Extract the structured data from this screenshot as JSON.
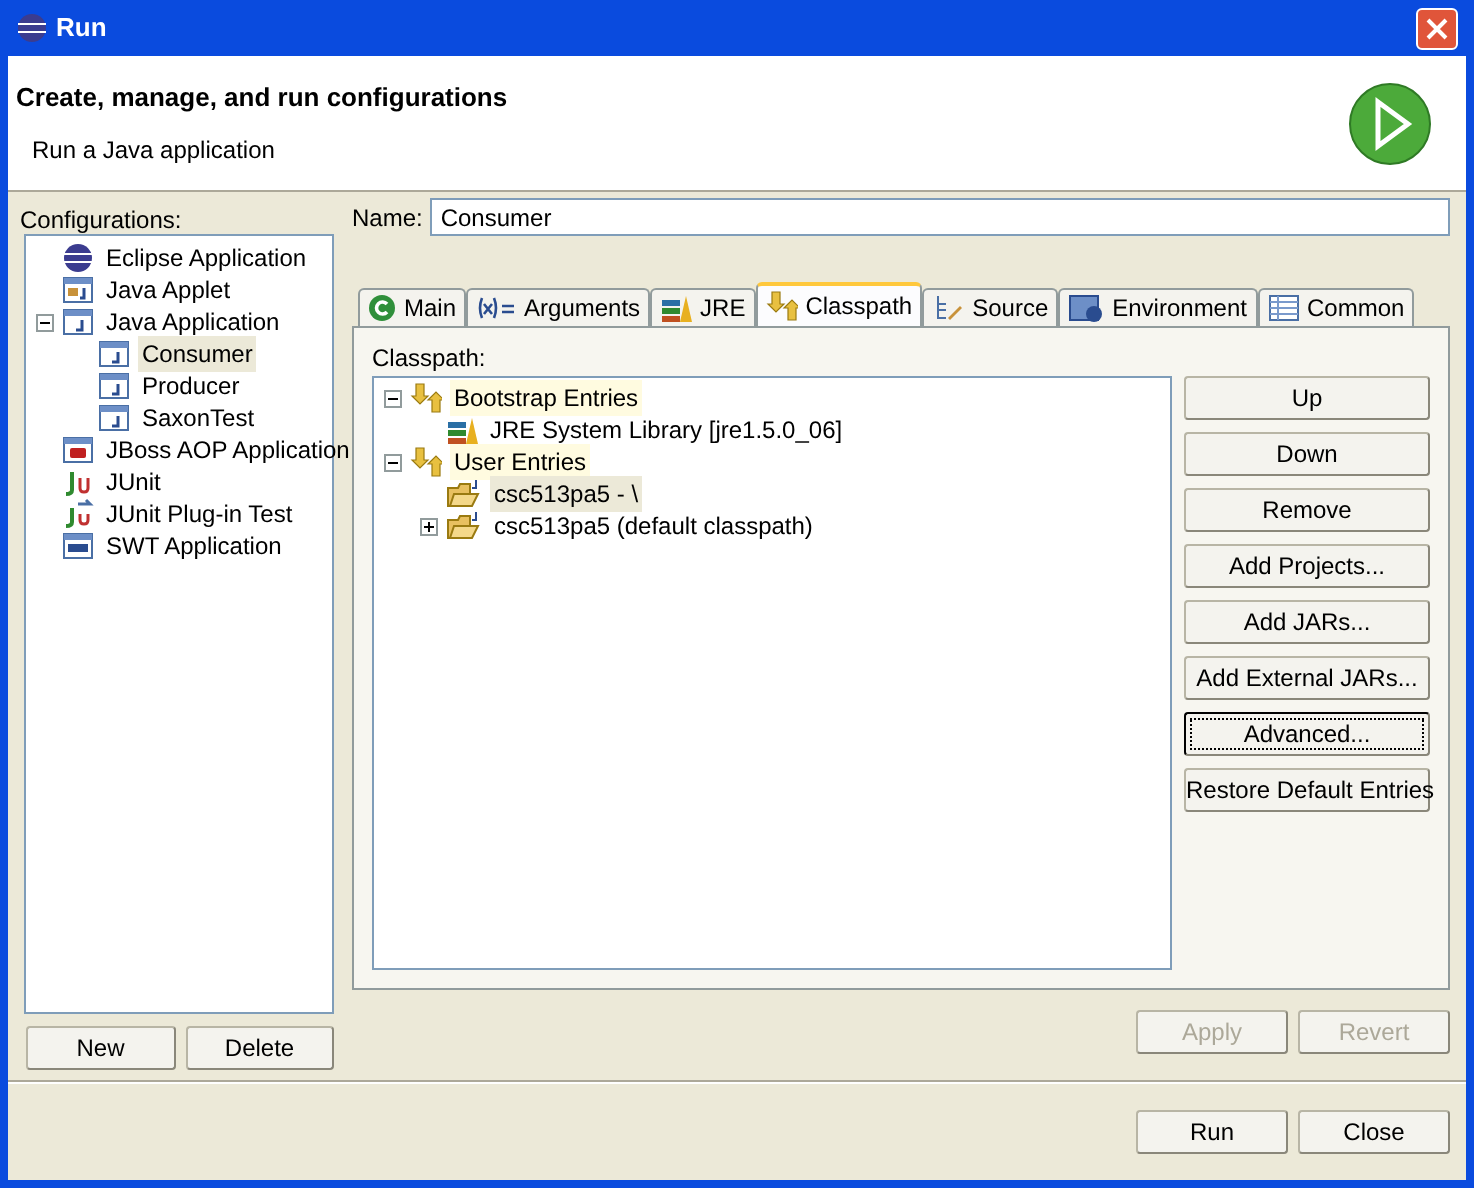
{
  "window": {
    "title": "Run"
  },
  "header": {
    "title": "Create, manage, and run configurations",
    "subtitle": "Run a Java application"
  },
  "configurations": {
    "label": "Configurations:",
    "items": [
      {
        "label": "Eclipse Application",
        "kind": "eclipse",
        "selected": false
      },
      {
        "label": "Java Applet",
        "kind": "applet",
        "selected": false
      },
      {
        "label": "Java Application",
        "kind": "java",
        "selected": false,
        "expanded": true,
        "children": [
          {
            "label": "Consumer",
            "kind": "java",
            "selected": true
          },
          {
            "label": "Producer",
            "kind": "java",
            "selected": false
          },
          {
            "label": "SaxonTest",
            "kind": "java",
            "selected": false
          }
        ]
      },
      {
        "label": "JBoss AOP Application",
        "kind": "jboss",
        "selected": false
      },
      {
        "label": "JUnit",
        "kind": "junit",
        "selected": false
      },
      {
        "label": "JUnit Plug-in Test",
        "kind": "junitplugin",
        "selected": false
      },
      {
        "label": "SWT Application",
        "kind": "swt",
        "selected": false
      }
    ],
    "buttons": [
      "New",
      "Delete"
    ]
  },
  "name": {
    "label": "Name:",
    "value": "Consumer"
  },
  "tabs": [
    {
      "label": "Main",
      "kind": "main",
      "selected": false
    },
    {
      "label": "Arguments",
      "kind": "args",
      "selected": false
    },
    {
      "label": "JRE",
      "kind": "jre",
      "selected": false
    },
    {
      "label": "Classpath",
      "kind": "classpath",
      "selected": true
    },
    {
      "label": "Source",
      "kind": "source",
      "selected": false
    },
    {
      "label": "Environment",
      "kind": "env",
      "selected": false
    },
    {
      "label": "Common",
      "kind": "common",
      "selected": false
    }
  ],
  "classpath": {
    "label": "Classpath:",
    "items": [
      {
        "label": "Bootstrap Entries",
        "kind": "category",
        "selected": false,
        "expanded": true,
        "children": [
          {
            "label": "JRE System Library [jre1.5.0_06]",
            "kind": "library",
            "selected": false
          }
        ]
      },
      {
        "label": "User Entries",
        "kind": "category",
        "selected": false,
        "expanded": true,
        "children": [
          {
            "label": "csc513pa5 - \\",
            "kind": "project",
            "selected": true
          },
          {
            "label": "csc513pa5 (default classpath)",
            "kind": "project",
            "selected": false,
            "expanded": false
          }
        ]
      }
    ],
    "buttons": [
      {
        "label": "Up",
        "focused": false
      },
      {
        "label": "Down",
        "focused": false
      },
      {
        "label": "Remove",
        "focused": false
      },
      {
        "label": "Add Projects...",
        "focused": false
      },
      {
        "label": "Add JARs...",
        "focused": false
      },
      {
        "label": "Add External JARs...",
        "focused": false
      },
      {
        "label": "Advanced...",
        "focused": true
      },
      {
        "label": "Restore Default Entries",
        "focused": false
      }
    ]
  },
  "actions": [
    {
      "label": "Apply",
      "disabled": true
    },
    {
      "label": "Revert",
      "disabled": true
    }
  ],
  "footer": [
    {
      "label": "Run"
    },
    {
      "label": "Close"
    }
  ]
}
